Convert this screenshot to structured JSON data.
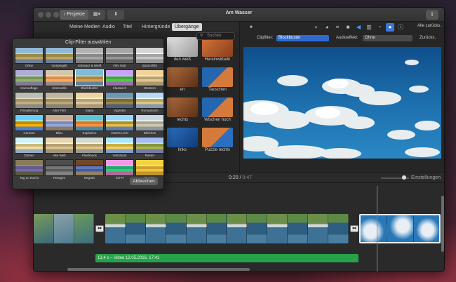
{
  "window": {
    "title": "Am Wasser",
    "back_button": "Projekte"
  },
  "browser_tabs": [
    "Meine Medien",
    "Audio",
    "Titel",
    "Hintergründe",
    "Übergänge"
  ],
  "browser_tab_active": "Übergänge",
  "browser_search_placeholder": "Suchen",
  "transitions": [
    {
      "label": "den weiß",
      "style": "bw"
    },
    {
      "label": "Hereinwirbeln",
      "style": "swirl"
    },
    {
      "label": "en",
      "style": "sepia"
    },
    {
      "label": "Tauschen",
      "style": "swap"
    },
    {
      "label": "rechts",
      "style": "sepia"
    },
    {
      "label": "Wischen hoch",
      "style": "swap"
    },
    {
      "label": "links",
      "style": "blue"
    },
    {
      "label": "Puzzle rechts",
      "style": "puzzle"
    }
  ],
  "inspector": {
    "reset_all": "Alle zurücks.",
    "clip_filter_label": "Clipfilter:",
    "clip_filter_value": "Blockbuster",
    "audio_effect_label": "Audioeffekt:",
    "audio_effect_value": "Ohne",
    "reset": "Zurücks."
  },
  "timecode": {
    "current": "0:20",
    "separator": "/",
    "duration": "0:47"
  },
  "settings_label": "Einstellungen",
  "audio_clip_label": "13,4 s – Video 12.05.2016, 17:41",
  "dialog": {
    "title": "Clip-Filter auswählen",
    "cancel": "Abbrechen",
    "selected": "Blockbuster",
    "filters": [
      "Ohne",
      "Gespiegelt",
      "Schwarz & Weiß",
      "Film Noir",
      "Stummfilm",
      "Camouflage",
      "Hitzewelle",
      "Blockbuster",
      "Klassisch",
      "Western",
      "Filmalterung",
      "Alter Film",
      "Sepia",
      "Vignette",
      "Romantisch",
      "Cartoon",
      "Blau",
      "Explosion",
      "Hartes Licht",
      "Bleichen",
      "Glühen",
      "Alte Welt",
      "Flashback",
      "Verträumt",
      "Raster",
      "Tag zu Nacht",
      "Röntgen",
      "Negativ",
      "Sci-Fi",
      "Duoton"
    ]
  },
  "colors": {
    "accent": "#2f6ad0",
    "audio_green": "#28a24a"
  }
}
